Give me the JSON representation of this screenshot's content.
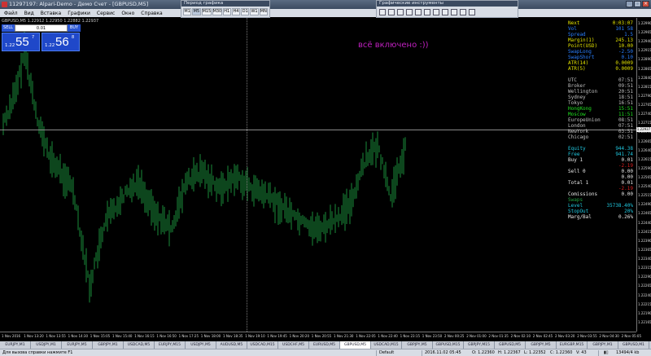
{
  "window": {
    "title": "11297197: Alpari-Demo - Демо Счет - [GBPUSD,M5]"
  },
  "menu": [
    "Файл",
    "Вид",
    "Вставка",
    "Графики",
    "Сервис",
    "Окно",
    "Справка"
  ],
  "timeframes_panel": {
    "title": "Период графика",
    "buttons": [
      "M1",
      "M5",
      "M15",
      "M30",
      "H1",
      "H4",
      "D1",
      "W1",
      "MN"
    ],
    "active": "M5"
  },
  "tools_panel": {
    "title": "Графические инструменты"
  },
  "chart": {
    "header": "GBPUSD,M5  1.22912 1.22950 1.22882 1.22937",
    "annotation": "всё включено :))",
    "current_price": "1.22937",
    "one_click": {
      "sell_label": "SELL",
      "buy_label": "BUY",
      "lot": "0.01",
      "bid_prefix": "1.22",
      "bid_big": "55",
      "bid_sup": "7",
      "ask_prefix": "1.22",
      "ask_big": "56",
      "ask_sup": "8"
    },
    "price_ticks": [
      "1.22990",
      "1.22965",
      "1.22940",
      "1.22915",
      "1.22890",
      "1.22865",
      "1.22840",
      "1.22815",
      "1.22790",
      "1.22765",
      "1.22740",
      "1.22715",
      "1.22690",
      "1.22665",
      "1.22640",
      "1.22615",
      "1.22590",
      "1.22565",
      "1.22540",
      "1.22515",
      "1.22490",
      "1.22465",
      "1.22440",
      "1.22415",
      "1.22390",
      "1.22365",
      "1.22340",
      "1.22315",
      "1.22290",
      "1.22265",
      "1.22240",
      "1.22215",
      "1.22190",
      "1.22165"
    ],
    "time_ticks": [
      "1 Nov 2016",
      "1 Nov 13:20",
      "1 Nov 13:55",
      "1 Nov 14:30",
      "1 Nov 15:05",
      "1 Nov 15:40",
      "1 Nov 16:15",
      "1 Nov 16:50",
      "1 Nov 17:25",
      "1 Nov 18:00",
      "1 Nov 18:35",
      "1 Nov 19:10",
      "1 Nov 19:45",
      "1 Nov 20:20",
      "1 Nov 20:55",
      "1 Nov 21:30",
      "1 Nov 22:05",
      "1 Nov 22:40",
      "1 Nov 23:15",
      "1 Nov 23:50",
      "2 Nov 00:25",
      "2 Nov 01:00",
      "2 Nov 01:35",
      "2 Nov 02:10",
      "2 Nov 02:45",
      "2 Nov 03:20",
      "2 Nov 03:55",
      "2 Nov 04:30",
      "2 Nov 05:05"
    ],
    "bar_color": "#1a8c3a"
  },
  "info": {
    "block1": [
      {
        "label": "Next",
        "value": "0:03:07",
        "color": "#e0e000"
      },
      {
        "label": "Vol",
        "value": "101   58",
        "color": "#2a7fff"
      },
      {
        "label": "Spread",
        "value": "1.5",
        "color": "#2a7fff"
      },
      {
        "label": "Margin(1)",
        "value": "245.13",
        "color": "#e0e000"
      },
      {
        "label": "Point(USD)",
        "value": "10.00",
        "color": "#e0e000"
      },
      {
        "label": "SwapLong",
        "value": "-2.50",
        "color": "#2a7fff"
      },
      {
        "label": "SwapShort",
        "value": "0.10",
        "color": "#2a7fff"
      },
      {
        "label": "ATR(14)",
        "value": "0.0009",
        "color": "#e0e000"
      },
      {
        "label": "ATR(5)",
        "value": "0.0009",
        "color": "#e0e000"
      }
    ],
    "block2": [
      {
        "label": "UTC",
        "value": "07:51",
        "color": "#c0c0c0"
      },
      {
        "label": "Broker",
        "value": "09:51",
        "color": "#c0c0c0"
      },
      {
        "label": "Wellington",
        "value": "20:51",
        "color": "#c0c0c0"
      },
      {
        "label": "Sydney",
        "value": "18:51",
        "color": "#c0c0c0"
      },
      {
        "label": "Tokyo",
        "value": "16:51",
        "color": "#c0c0c0"
      },
      {
        "label": "HongKong",
        "value": "15:51",
        "color": "#20e020"
      },
      {
        "label": "Moscow",
        "value": "11:51",
        "color": "#20e020"
      },
      {
        "label": "EuropeUnion",
        "value": "08:51",
        "color": "#c0c0c0"
      },
      {
        "label": "London",
        "value": "07:51",
        "color": "#c0c0c0"
      },
      {
        "label": "NewYork",
        "value": "03:51",
        "color": "#c0c0c0"
      },
      {
        "label": "Chicago",
        "value": "02:51",
        "color": "#c0c0c0"
      }
    ],
    "block3": [
      {
        "label": "Equity",
        "value": "944.38",
        "color": "#20c8e0"
      },
      {
        "label": "Free",
        "value": "941.74",
        "color": "#20c8e0"
      },
      {
        "label": "Buy     1",
        "value": "0.01",
        "color": "#e8e8e8"
      },
      {
        "label": "",
        "value": "-2.19",
        "color": "#e02020"
      },
      {
        "label": "Sell    0",
        "value": "0.00",
        "color": "#e8e8e8"
      },
      {
        "label": "",
        "value": "0.00",
        "color": "#e8e8e8"
      },
      {
        "label": "Total   1",
        "value": "0.01",
        "color": "#e8e8e8"
      },
      {
        "label": "",
        "value": "-2.19",
        "color": "#e02020"
      },
      {
        "label": "Comissions",
        "value": "0.00",
        "color": "#e8e8e8"
      },
      {
        "label": "Swaps",
        "value": "",
        "color": "#20a040"
      },
      {
        "label": "Level",
        "value": "35738.40%",
        "color": "#20c8e0"
      },
      {
        "label": "StopOut",
        "value": "20%",
        "color": "#20c8e0"
      },
      {
        "label": "Marg/Bal",
        "value": "0.26%",
        "color": "#e8e8e8"
      }
    ]
  },
  "tabs": [
    "EURJPY,M1",
    "USDJPY,M1",
    "EURJPY,M5",
    "GBPJPY,M1",
    "USDCAD,M5",
    "EURJPY,M15",
    "USDJPY,M5",
    "AUDUSD,M5",
    "USDCAD,M15",
    "USDCHF,M5",
    "EURUSD,M5",
    "GBPUSD,M5",
    "USDCAD,M15",
    "GBPJPY,M5",
    "GBPUSD,M15",
    "GBPJPY,M15",
    "GBPUSD,M5",
    "GBPJPY,M5",
    "EURGBP,M15",
    "GBPJPY,M1",
    "GBPUSD,M1"
  ],
  "active_tab": "GBPUSD,M5",
  "status": {
    "help": "Для вызова справки нажмите F1",
    "profile": "Default",
    "time": "2016.11.02 05:45",
    "open": "O: 1.22360",
    "high": "H: 1.22367",
    "low": "L: 1.22352",
    "close": "C: 1.22360",
    "volume": "V: 43",
    "traffic": "13494/4 kb"
  }
}
